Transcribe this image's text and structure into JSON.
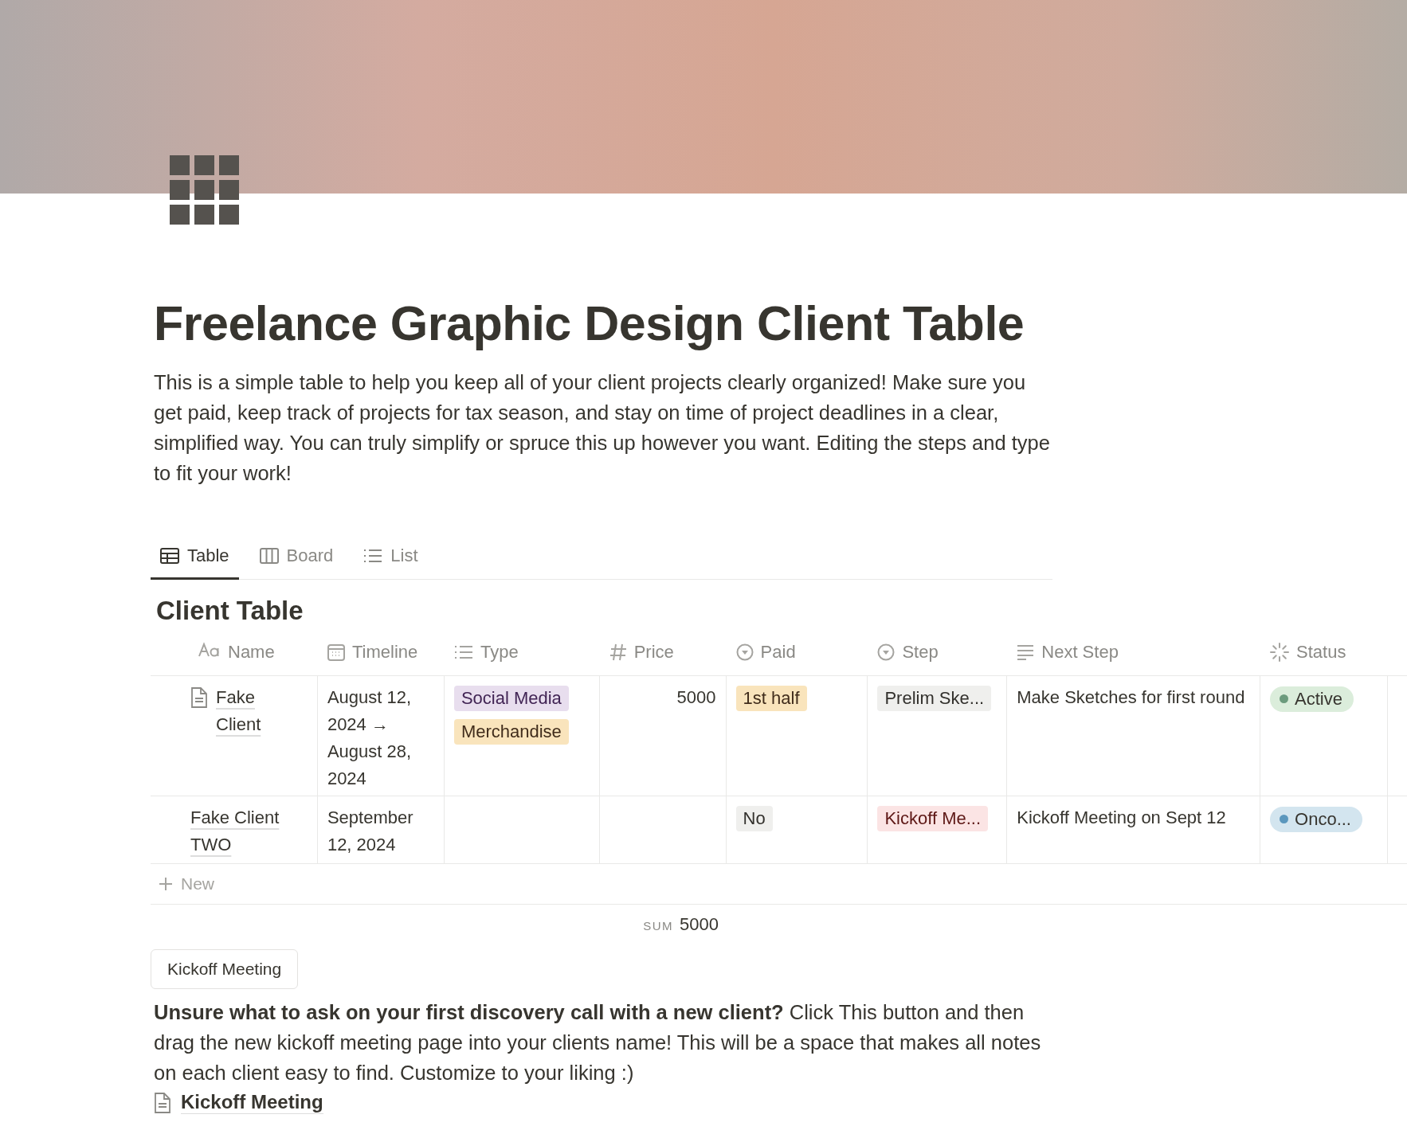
{
  "title": "Freelance Graphic Design Client Table",
  "description": "This is a simple table to help you keep all of your client projects clearly organized! Make sure you get paid, keep track of projects for tax season, and stay on time of project deadlines in a clear, simplified way. You can truly simplify or spruce this up however you want. Editing the steps and type to fit your work!",
  "views": [
    {
      "label": "Table",
      "selected": true
    },
    {
      "label": "Board",
      "selected": false
    },
    {
      "label": "List",
      "selected": false
    }
  ],
  "table": {
    "title": "Client Table",
    "columns": [
      {
        "label": "Name"
      },
      {
        "label": "Timeline"
      },
      {
        "label": "Type"
      },
      {
        "label": "Price"
      },
      {
        "label": "Paid"
      },
      {
        "label": "Step"
      },
      {
        "label": "Next Step"
      },
      {
        "label": "Status"
      }
    ],
    "rows": [
      {
        "name": "Fake Client",
        "page_icon": true,
        "timeline": "August 12, 2024 → August 28, 2024",
        "type": [
          {
            "label": "Social Media",
            "color": "#e8deee"
          },
          {
            "label": "Merchandise",
            "color": "#f9e4bc"
          }
        ],
        "price": "5000",
        "paid": {
          "label": "1st half",
          "color": "#f9e4bc"
        },
        "step": {
          "label": "Prelim Ske...",
          "color": "#efefed"
        },
        "next_step": "Make Sketches for first round",
        "status": {
          "label": "Active",
          "color": "#6c9b7d"
        }
      },
      {
        "name": "Fake Client TWO",
        "page_icon": false,
        "timeline": "September 12, 2024",
        "type": [],
        "price": "",
        "paid": {
          "label": "No",
          "color": "#efefed"
        },
        "step": {
          "label": "Kickoff Me...",
          "color": "#fbe4e4"
        },
        "next_step": "Kickoff Meeting on Sept 12",
        "status": {
          "label": "Onco...",
          "color": "#5b97bd"
        }
      }
    ],
    "new_label": "New",
    "sum": {
      "label": "SUM",
      "value": "5000"
    }
  },
  "button": "Kickoff Meeting",
  "note": "**Unsure what to ask on your first discovery call with a new client?** Click This button and then drag the new kickoff meeting page into your clients name! This will be a space that makes all notes on each client easy to find. Customize to your liking :)",
  "page_link": "Kickoff Meeting"
}
